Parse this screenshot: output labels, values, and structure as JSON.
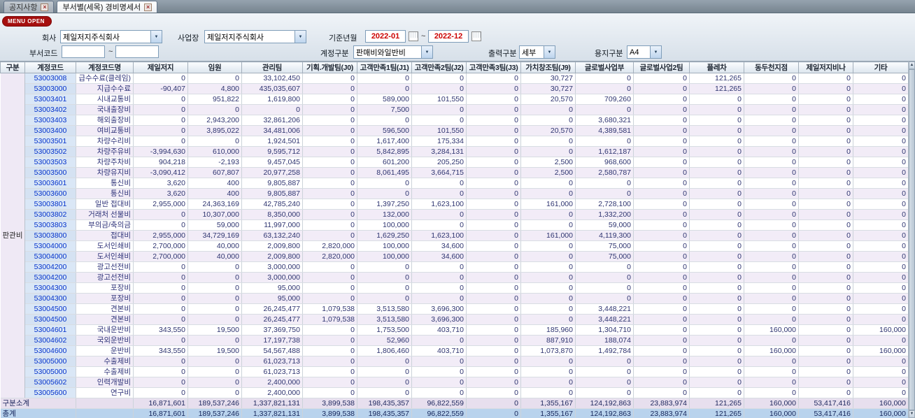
{
  "tabs": [
    {
      "label": "공지사항",
      "active": false
    },
    {
      "label": "부서별(세목) 경비명세서",
      "active": true
    }
  ],
  "menu_open_label": "MENU OPEN",
  "icons": {
    "tab_close": "×",
    "combo_arrow": "▼",
    "scroll_up": "▲",
    "scroll_down": "▼"
  },
  "colors": {
    "accent_red": "#a50f0f",
    "date_text": "#cc0000",
    "alt_row": "#f2ecf7",
    "total_row": "#b9d3ed"
  },
  "filters": {
    "company_label": "회사",
    "company_value": "제일저지주식회사",
    "site_label": "사업장",
    "site_value": "제일저지주식회사",
    "period_label": "기준년월",
    "period_from": "2022-01",
    "period_to": "2022-12",
    "tilde": "~",
    "dept_code_label": "부서코드",
    "dept_code_from": "",
    "dept_code_to": "",
    "account_type_label": "계정구분",
    "account_type_value": "판매비와일반비",
    "output_type_label": "출력구분",
    "output_type_value": "세부",
    "paper_type_label": "용지구분",
    "paper_type_value": "A4"
  },
  "table": {
    "headers": [
      "구분",
      "계정코드",
      "계정코드명",
      "제일저지",
      "임원",
      "관리팀",
      "기획.개발팀(J0)",
      "고객만족1팀(J1)",
      "고객만족2팀(J2)",
      "고객만족3팀(J3)",
      "가치창조팀(J9)",
      "글로벌사업부",
      "글로벌사업2팀",
      "플레차",
      "동두천지점",
      "제일저지비나",
      "기타"
    ],
    "group_label": "판관비",
    "rows": [
      {
        "code": "53003008",
        "name": "급수수료(클레임)",
        "values": [
          "0",
          "0",
          "33,102,450",
          "0",
          "0",
          "0",
          "0",
          "30,727",
          "0",
          "0",
          "121,265",
          "0",
          "0",
          "0"
        ]
      },
      {
        "code": "53003000",
        "name": "지급수수료",
        "values": [
          "-90,407",
          "4,800",
          "435,035,607",
          "0",
          "0",
          "0",
          "0",
          "30,727",
          "0",
          "0",
          "121,265",
          "0",
          "0",
          "0"
        ]
      },
      {
        "code": "53003401",
        "name": "시내교통비",
        "values": [
          "0",
          "951,822",
          "1,619,800",
          "0",
          "589,000",
          "101,550",
          "0",
          "20,570",
          "709,260",
          "0",
          "0",
          "0",
          "0",
          "0"
        ]
      },
      {
        "code": "53003402",
        "name": "국내출장비",
        "values": [
          "0",
          "0",
          "0",
          "0",
          "7,500",
          "0",
          "0",
          "0",
          "0",
          "0",
          "0",
          "0",
          "0",
          "0"
        ]
      },
      {
        "code": "53003403",
        "name": "해외출장비",
        "values": [
          "0",
          "2,943,200",
          "32,861,206",
          "0",
          "0",
          "0",
          "0",
          "0",
          "3,680,321",
          "0",
          "0",
          "0",
          "0",
          "0"
        ]
      },
      {
        "code": "53003400",
        "name": "여비교통비",
        "values": [
          "0",
          "3,895,022",
          "34,481,006",
          "0",
          "596,500",
          "101,550",
          "0",
          "20,570",
          "4,389,581",
          "0",
          "0",
          "0",
          "0",
          "0"
        ]
      },
      {
        "code": "53003501",
        "name": "차량수리비",
        "values": [
          "0",
          "0",
          "1,924,501",
          "0",
          "1,617,400",
          "175,334",
          "0",
          "0",
          "0",
          "0",
          "0",
          "0",
          "0",
          "0"
        ]
      },
      {
        "code": "53003502",
        "name": "차량주유비",
        "values": [
          "-3,994,630",
          "610,000",
          "9,595,712",
          "0",
          "5,842,895",
          "3,284,131",
          "0",
          "0",
          "1,612,187",
          "0",
          "0",
          "0",
          "0",
          "0"
        ]
      },
      {
        "code": "53003503",
        "name": "차량주차비",
        "values": [
          "904,218",
          "-2,193",
          "9,457,045",
          "0",
          "601,200",
          "205,250",
          "0",
          "2,500",
          "968,600",
          "0",
          "0",
          "0",
          "0",
          "0"
        ]
      },
      {
        "code": "53003500",
        "name": "차량유지비",
        "values": [
          "-3,090,412",
          "607,807",
          "20,977,258",
          "0",
          "8,061,495",
          "3,664,715",
          "0",
          "2,500",
          "2,580,787",
          "0",
          "0",
          "0",
          "0",
          "0"
        ]
      },
      {
        "code": "53003601",
        "name": "통신비",
        "values": [
          "3,620",
          "400",
          "9,805,887",
          "0",
          "0",
          "0",
          "0",
          "0",
          "0",
          "0",
          "0",
          "0",
          "0",
          "0"
        ]
      },
      {
        "code": "53003600",
        "name": "통신비",
        "values": [
          "3,620",
          "400",
          "9,805,887",
          "0",
          "0",
          "0",
          "0",
          "0",
          "0",
          "0",
          "0",
          "0",
          "0",
          "0"
        ]
      },
      {
        "code": "53003801",
        "name": "일반 접대비",
        "values": [
          "2,955,000",
          "24,363,169",
          "42,785,240",
          "0",
          "1,397,250",
          "1,623,100",
          "0",
          "161,000",
          "2,728,100",
          "0",
          "0",
          "0",
          "0",
          "0"
        ]
      },
      {
        "code": "53003802",
        "name": "거래처 선물비",
        "values": [
          "0",
          "10,307,000",
          "8,350,000",
          "0",
          "132,000",
          "0",
          "0",
          "0",
          "1,332,200",
          "0",
          "0",
          "0",
          "0",
          "0"
        ]
      },
      {
        "code": "53003803",
        "name": "부의금/축의금",
        "values": [
          "0",
          "59,000",
          "11,997,000",
          "0",
          "100,000",
          "0",
          "0",
          "0",
          "59,000",
          "0",
          "0",
          "0",
          "0",
          "0"
        ]
      },
      {
        "code": "53003800",
        "name": "접대비",
        "values": [
          "2,955,000",
          "34,729,169",
          "63,132,240",
          "0",
          "1,629,250",
          "1,623,100",
          "0",
          "161,000",
          "4,119,300",
          "0",
          "0",
          "0",
          "0",
          "0"
        ]
      },
      {
        "code": "53004000",
        "name": "도서인쇄비",
        "values": [
          "2,700,000",
          "40,000",
          "2,009,800",
          "2,820,000",
          "100,000",
          "34,600",
          "0",
          "0",
          "75,000",
          "0",
          "0",
          "0",
          "0",
          "0"
        ]
      },
      {
        "code": "53004000",
        "name": "도서인쇄비",
        "values": [
          "2,700,000",
          "40,000",
          "2,009,800",
          "2,820,000",
          "100,000",
          "34,600",
          "0",
          "0",
          "75,000",
          "0",
          "0",
          "0",
          "0",
          "0"
        ]
      },
      {
        "code": "53004200",
        "name": "광고선전비",
        "values": [
          "0",
          "0",
          "3,000,000",
          "0",
          "0",
          "0",
          "0",
          "0",
          "0",
          "0",
          "0",
          "0",
          "0",
          "0"
        ]
      },
      {
        "code": "53004200",
        "name": "광고선전비",
        "values": [
          "0",
          "0",
          "3,000,000",
          "0",
          "0",
          "0",
          "0",
          "0",
          "0",
          "0",
          "0",
          "0",
          "0",
          "0"
        ]
      },
      {
        "code": "53004300",
        "name": "포장비",
        "values": [
          "0",
          "0",
          "95,000",
          "0",
          "0",
          "0",
          "0",
          "0",
          "0",
          "0",
          "0",
          "0",
          "0",
          "0"
        ]
      },
      {
        "code": "53004300",
        "name": "포장비",
        "values": [
          "0",
          "0",
          "95,000",
          "0",
          "0",
          "0",
          "0",
          "0",
          "0",
          "0",
          "0",
          "0",
          "0",
          "0"
        ]
      },
      {
        "code": "53004500",
        "name": "견본비",
        "values": [
          "0",
          "0",
          "26,245,477",
          "1,079,538",
          "3,513,580",
          "3,696,300",
          "0",
          "0",
          "3,448,221",
          "0",
          "0",
          "0",
          "0",
          "0"
        ]
      },
      {
        "code": "53004500",
        "name": "견본비",
        "values": [
          "0",
          "0",
          "26,245,477",
          "1,079,538",
          "3,513,580",
          "3,696,300",
          "0",
          "0",
          "3,448,221",
          "0",
          "0",
          "0",
          "0",
          "0"
        ]
      },
      {
        "code": "53004601",
        "name": "국내운반비",
        "values": [
          "343,550",
          "19,500",
          "37,369,750",
          "0",
          "1,753,500",
          "403,710",
          "0",
          "185,960",
          "1,304,710",
          "0",
          "0",
          "160,000",
          "0",
          "160,000"
        ]
      },
      {
        "code": "53004602",
        "name": "국외운반비",
        "values": [
          "0",
          "0",
          "17,197,738",
          "0",
          "52,960",
          "0",
          "0",
          "887,910",
          "188,074",
          "0",
          "0",
          "0",
          "0",
          "0"
        ]
      },
      {
        "code": "53004600",
        "name": "운반비",
        "values": [
          "343,550",
          "19,500",
          "54,567,488",
          "0",
          "1,806,460",
          "403,710",
          "0",
          "1,073,870",
          "1,492,784",
          "0",
          "0",
          "160,000",
          "0",
          "160,000"
        ]
      },
      {
        "code": "53005000",
        "name": "수출제비",
        "values": [
          "0",
          "0",
          "61,023,713",
          "0",
          "0",
          "0",
          "0",
          "0",
          "0",
          "0",
          "0",
          "0",
          "0",
          "0"
        ]
      },
      {
        "code": "53005000",
        "name": "수출제비",
        "values": [
          "0",
          "0",
          "61,023,713",
          "0",
          "0",
          "0",
          "0",
          "0",
          "0",
          "0",
          "0",
          "0",
          "0",
          "0"
        ]
      },
      {
        "code": "53005602",
        "name": "인력개발비",
        "values": [
          "0",
          "0",
          "2,400,000",
          "0",
          "0",
          "0",
          "0",
          "0",
          "0",
          "0",
          "0",
          "0",
          "0",
          "0"
        ]
      },
      {
        "code": "53005600",
        "name": "연구비",
        "values": [
          "0",
          "0",
          "2,400,000",
          "0",
          "0",
          "0",
          "0",
          "0",
          "0",
          "0",
          "0",
          "0",
          "0",
          "0"
        ]
      }
    ],
    "subtotal": {
      "label": "구분소계",
      "values": [
        "16,871,601",
        "189,537,246",
        "1,337,821,131",
        "3,899,538",
        "198,435,357",
        "96,822,559",
        "0",
        "1,355,167",
        "124,192,863",
        "23,883,974",
        "121,265",
        "160,000",
        "53,417,416",
        "160,000"
      ]
    },
    "total": {
      "label": "총계",
      "values": [
        "16,871,601",
        "189,537,246",
        "1,337,821,131",
        "3,899,538",
        "198,435,357",
        "96,822,559",
        "0",
        "1,355,167",
        "124,192,863",
        "23,883,974",
        "121,265",
        "160,000",
        "53,417,416",
        "160,000"
      ]
    }
  }
}
